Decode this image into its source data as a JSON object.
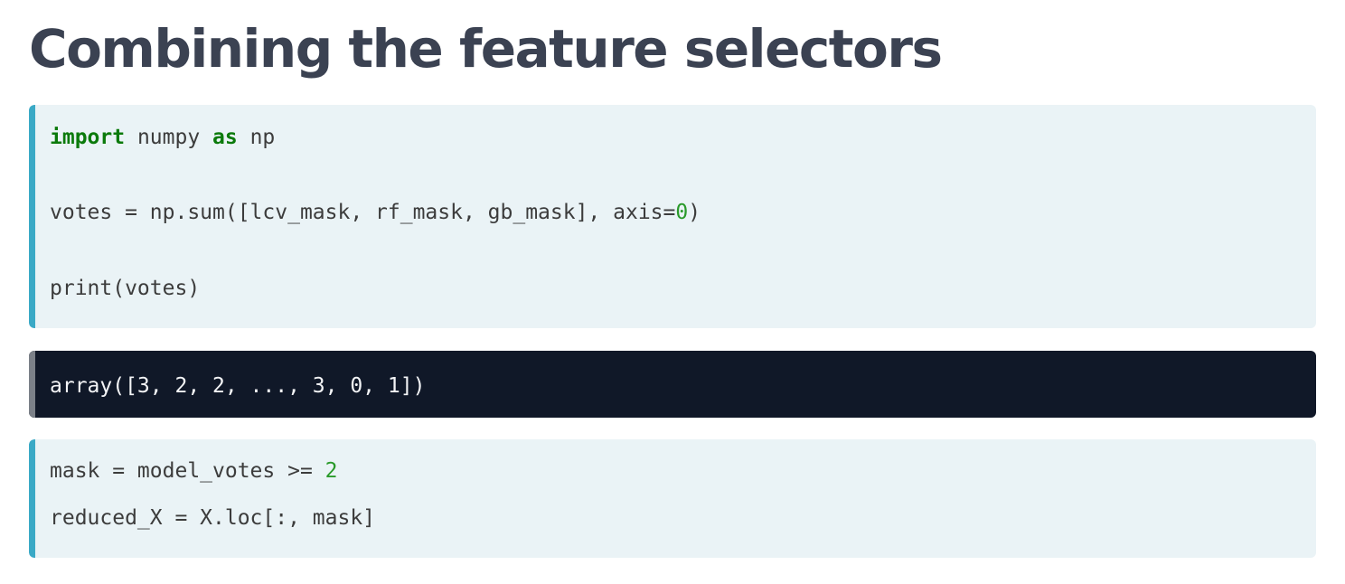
{
  "slide": {
    "title": "Combining the feature selectors"
  },
  "code_cell_1": {
    "kw_import": "import",
    "module": " numpy ",
    "kw_as": "as",
    "alias": " np",
    "line2_text": "votes = np.sum([lcv_mask, rf_mask, gb_mask], axis=",
    "line2_num": "0",
    "line2_end": ")",
    "line3_text": "print(votes)"
  },
  "output_cell": {
    "text": "array([3, 2, 2, ..., 3, 0, 1])"
  },
  "code_cell_2": {
    "line1_text": "mask = model_votes >= ",
    "line1_num": "2",
    "line2_text": "reduced_X = X.loc[:, mask]"
  },
  "colors": {
    "title": "#3b4252",
    "code_background": "#eaf3f6",
    "code_accent_bar": "#3aa9c6",
    "output_background": "#101828",
    "keyword": "#0b7a0b",
    "number": "#2a9a2a"
  }
}
